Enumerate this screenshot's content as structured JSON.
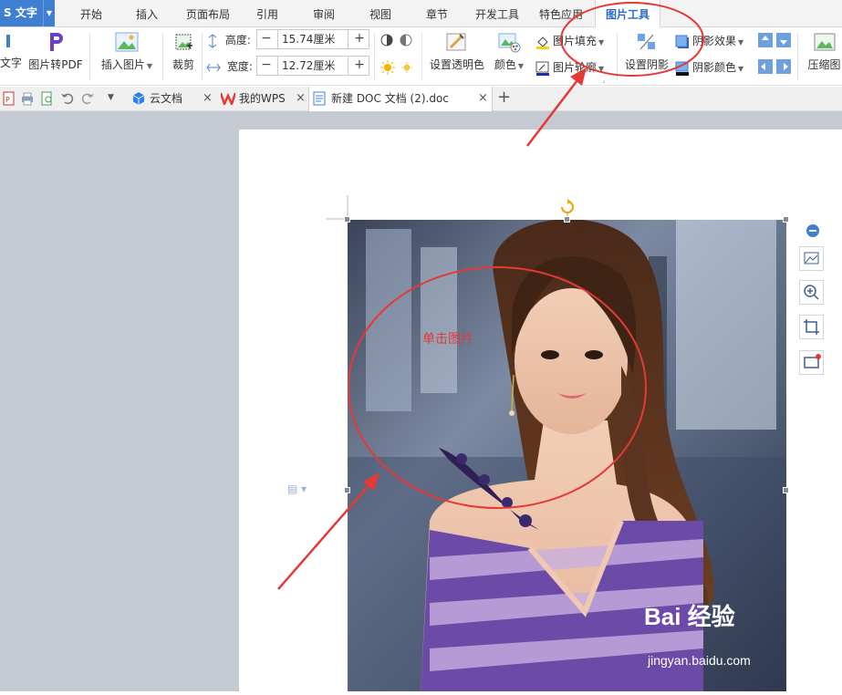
{
  "app": {
    "name": "S 文字"
  },
  "menu": {
    "tabs": [
      "开始",
      "插入",
      "页面布局",
      "引用",
      "审阅",
      "视图",
      "章节",
      "开发工具",
      "特色应用",
      "图片工具"
    ],
    "active_tab": "图片工具"
  },
  "ribbon": {
    "to_text_partial": "文字",
    "pdf_label": "图片转PDF",
    "insert_picture": "插入图片",
    "crop": "裁剪",
    "height_label": "高度:",
    "height_value": "15.74厘米",
    "width_label": "宽度:",
    "width_value": "12.72厘米",
    "set_transparent": "设置透明色",
    "color": "颜色",
    "picture_fill": "图片填充",
    "picture_outline": "图片轮廓",
    "set_shadow": "设置阴影",
    "shadow_effect": "阴影效果",
    "shadow_color": "阴影颜色",
    "compress": "压缩图"
  },
  "doc_tabs": [
    {
      "label": "云文档"
    },
    {
      "label": "我的WPS"
    },
    {
      "label": "新建 DOC 文档 (2).doc"
    }
  ],
  "annotation": {
    "click_picture": "单击图片",
    "color": "#e53935"
  },
  "watermark": {
    "logo": "Bai 经验",
    "url": "jingyan.baidu.com"
  },
  "colors": {
    "accent": "#3f7fd1",
    "active_tab_text": "#2a6bc9",
    "workspace": "#c5c9d1",
    "annotation_red": "#e53935"
  }
}
